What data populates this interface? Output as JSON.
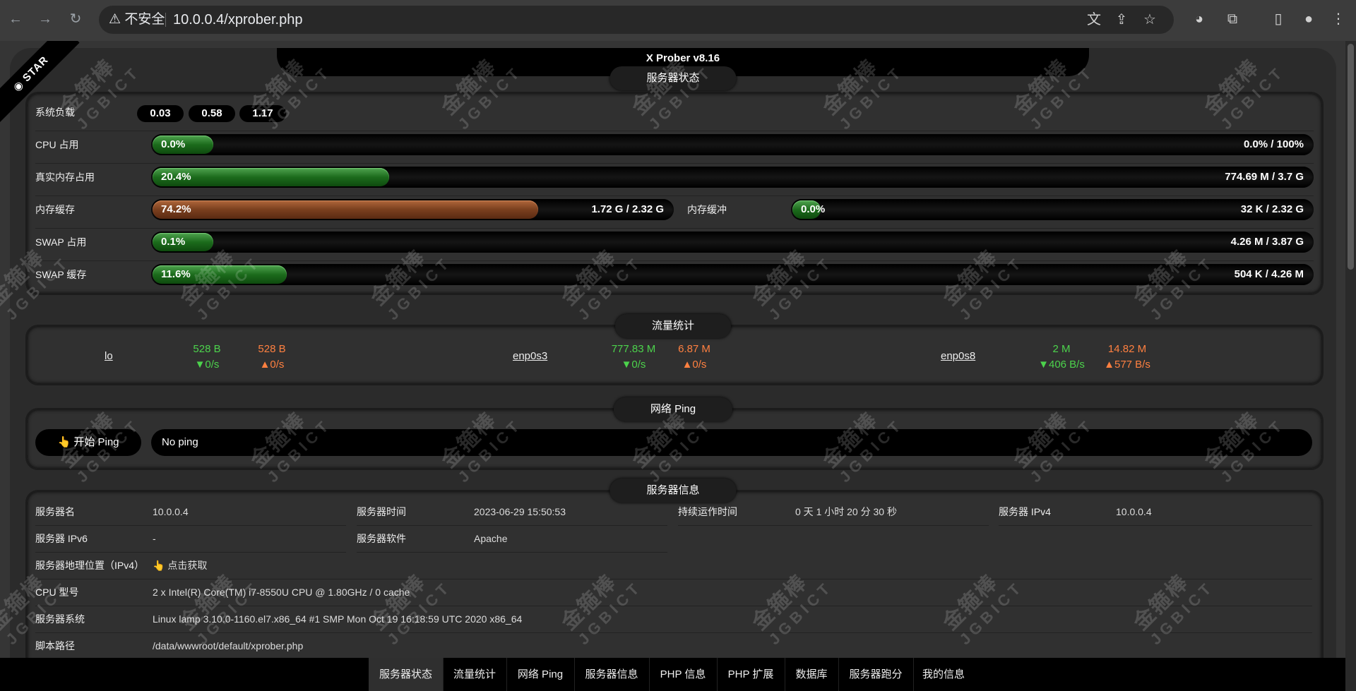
{
  "browser": {
    "url_warning": "不安全",
    "url": "10.0.0.4/xprober.php"
  },
  "app": {
    "title": "X Prober v8.16",
    "star_ribbon": "STAR",
    "watermark": "金箍棒 JGBICT"
  },
  "server_status": {
    "title": "服务器状态",
    "load_label": "系统负载",
    "loads": [
      "0.03",
      "0.58",
      "1.17"
    ],
    "cpu": {
      "label": "CPU 占用",
      "percent": 0.0,
      "percent_text": "0.0%",
      "right": "0.0% / 100%"
    },
    "real_mem": {
      "label": "真实内存占用",
      "percent": 20.4,
      "percent_text": "20.4%",
      "right": "774.69 M / 3.7 G"
    },
    "mem_cache": {
      "label": "内存缓存",
      "percent": 74.2,
      "percent_text": "74.2%",
      "right": "1.72 G / 2.32 G"
    },
    "mem_buffer": {
      "label": "内存缓冲",
      "percent": 0.0,
      "percent_text": "0.0%",
      "right": "32 K / 2.32 G"
    },
    "swap_used": {
      "label": "SWAP 占用",
      "percent": 0.1,
      "percent_text": "0.1%",
      "right": "4.26 M / 3.87 G"
    },
    "swap_cache": {
      "label": "SWAP 缓存",
      "percent": 11.6,
      "percent_text": "11.6%",
      "right": "504 K / 4.26 M"
    }
  },
  "traffic": {
    "title": "流量统计",
    "interfaces": [
      {
        "name": "lo",
        "rx_total": "528 B",
        "tx_total": "528 B",
        "rx_rate": "▼0/s",
        "tx_rate": "▲0/s"
      },
      {
        "name": "enp0s3",
        "rx_total": "777.83 M",
        "tx_total": "6.87 M",
        "rx_rate": "▼0/s",
        "tx_rate": "▲0/s"
      },
      {
        "name": "enp0s8",
        "rx_total": "2 M",
        "tx_total": "14.82 M",
        "rx_rate": "▼406 B/s",
        "tx_rate": "▲577 B/s"
      }
    ]
  },
  "ping": {
    "title": "网络 Ping",
    "button": "👆 开始 Ping",
    "result": "No ping"
  },
  "server_info": {
    "title": "服务器信息",
    "name": {
      "k": "服务器名",
      "v": "10.0.0.4"
    },
    "time": {
      "k": "服务器时间",
      "v": "2023-06-29 15:50:53"
    },
    "uptime": {
      "k": "持续运作时间",
      "v": "0 天 1 小时 20 分 30 秒"
    },
    "ipv4": {
      "k": "服务器 IPv4",
      "v": "10.0.0.4"
    },
    "ipv6": {
      "k": "服务器 IPv6",
      "v": "-"
    },
    "software": {
      "k": "服务器软件",
      "v": "Apache"
    },
    "geo": {
      "k": "服务器地理位置（IPv4）",
      "v": "👆 点击获取"
    },
    "cpu_model": {
      "k": "CPU 型号",
      "v": "2 x Intel(R) Core(TM) i7-8550U CPU @ 1.80GHz / 0 cache"
    },
    "os": {
      "k": "服务器系统",
      "v": "Linux lamp 3.10.0-1160.el7.x86_64 #1 SMP Mon Oct 19 16:18:59 UTC 2020 x86_64"
    },
    "script_path": {
      "k": "脚本路径",
      "v": "/data/wwwroot/default/xprober.php"
    }
  },
  "bottom_nav": [
    "服务器状态",
    "流量统计",
    "网络 Ping",
    "服务器信息",
    "PHP 信息",
    "PHP 扩展",
    "数据库",
    "服务器跑分",
    "我的信息"
  ]
}
